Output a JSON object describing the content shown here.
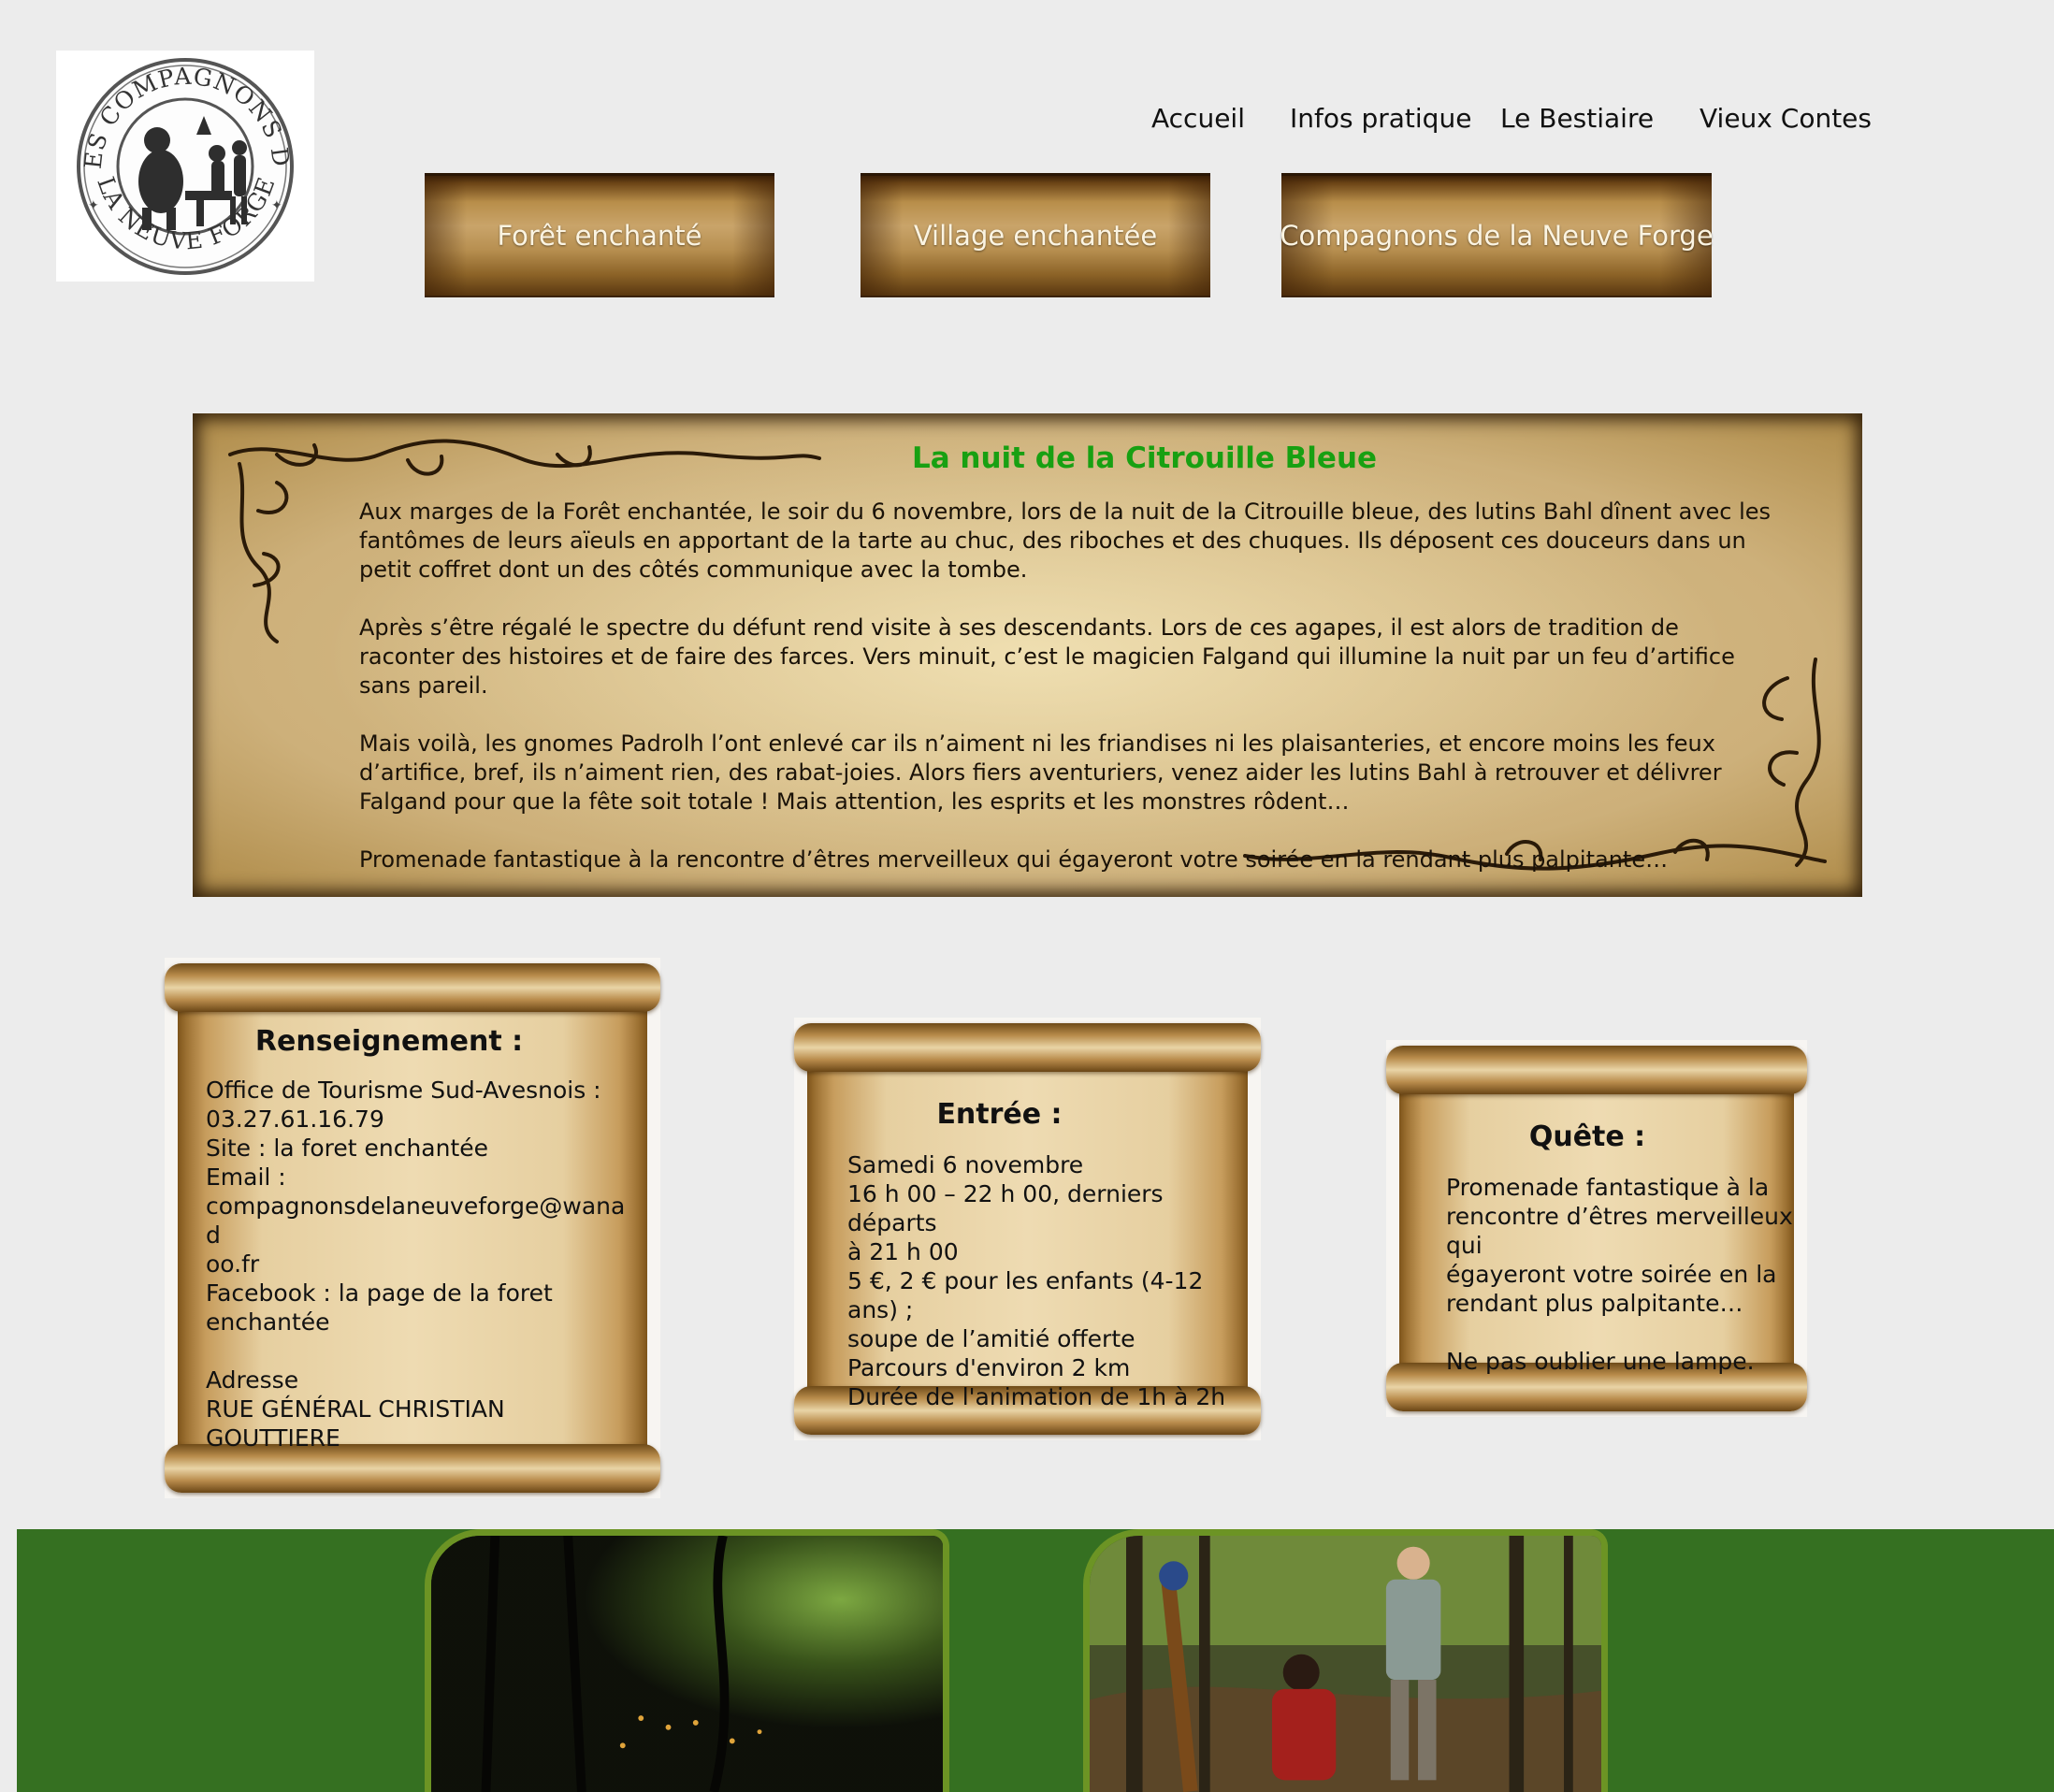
{
  "logo": {
    "ring_text_top": "LES COMPAGNONS DE",
    "ring_text_bottom": "LA NEUVE FORGE"
  },
  "top_nav": [
    "Accueil",
    "Infos pratique",
    "Le Bestiaire",
    "Vieux Contes"
  ],
  "plank_nav": [
    "Forêt enchanté",
    "Village enchantée",
    "Compagnons de la Neuve Forge"
  ],
  "main": {
    "title": "La nuit de la Citrouille Bleue",
    "paragraphs": [
      "Aux marges de la Forêt enchantée, le soir du 6 novembre, lors de la nuit de la Citrouille bleue, des lutins Bahl dînent avec les fantômes de leurs aïeuls en apportant de la tarte au chuc, des riboches et des chuques. Ils déposent ces douceurs dans un petit coffret dont un des côtés communique avec la tombe.",
      "Après s’être régalé le spectre du défunt rend visite à ses descendants. Lors de ces agapes, il est alors de tradition de raconter des histoires et de faire des farces. Vers minuit, c’est le magicien Falgand qui illumine la nuit par un feu d’artifice sans pareil.",
      "Mais voilà, les gnomes Padrolh l’ont enlevé car ils n’aiment ni les friandises ni les plaisanteries, et encore moins les feux d’artifice, bref, ils n’aiment rien, des rabat-joies. Alors fiers aventuriers, venez aider les lutins Bahl à retrouver et délivrer Falgand pour que la fête soit totale ! Mais attention, les esprits et les monstres rôdent…",
      "Promenade fantastique à la rencontre d’êtres merveilleux qui égayeront votre soirée en la rendant plus palpitante…"
    ]
  },
  "cards": {
    "renseignement": {
      "title": "Renseignement :",
      "lines": [
        "Office de Tourisme Sud-Avesnois :",
        "03.27.61.16.79",
        "Site : la foret enchantée",
        "Email :",
        "compagnonsdelaneuveforge@wanad",
        "oo.fr",
        "Facebook : la page de la foret",
        "enchantée",
        "",
        "Adresse",
        "RUE GÉNÉRAL CHRISTIAN",
        "GOUTTIERE"
      ]
    },
    "entree": {
      "title": "Entrée :",
      "lines": [
        "Samedi 6 novembre",
        "16 h 00 – 22 h 00, derniers départs",
        "à 21 h 00",
        "5 €, 2 € pour les enfants (4-12 ans) ;",
        "soupe de l’amitié offerte",
        "Parcours d'environ 2 km",
        "Durée de l'animation de 1h à 2h"
      ]
    },
    "quete": {
      "title": "Quête :",
      "lines": [
        "Promenade fantastique à la",
        "rencontre d’êtres merveilleux qui",
        "égayeront votre soirée en la",
        "rendant plus palpitante…",
        "",
        "Ne pas oublier une lampe."
      ]
    }
  },
  "colors": {
    "page_bg": "#ececec",
    "title_green": "#18a012",
    "footer_green": "#357021",
    "photo_border": "#6c9424"
  }
}
